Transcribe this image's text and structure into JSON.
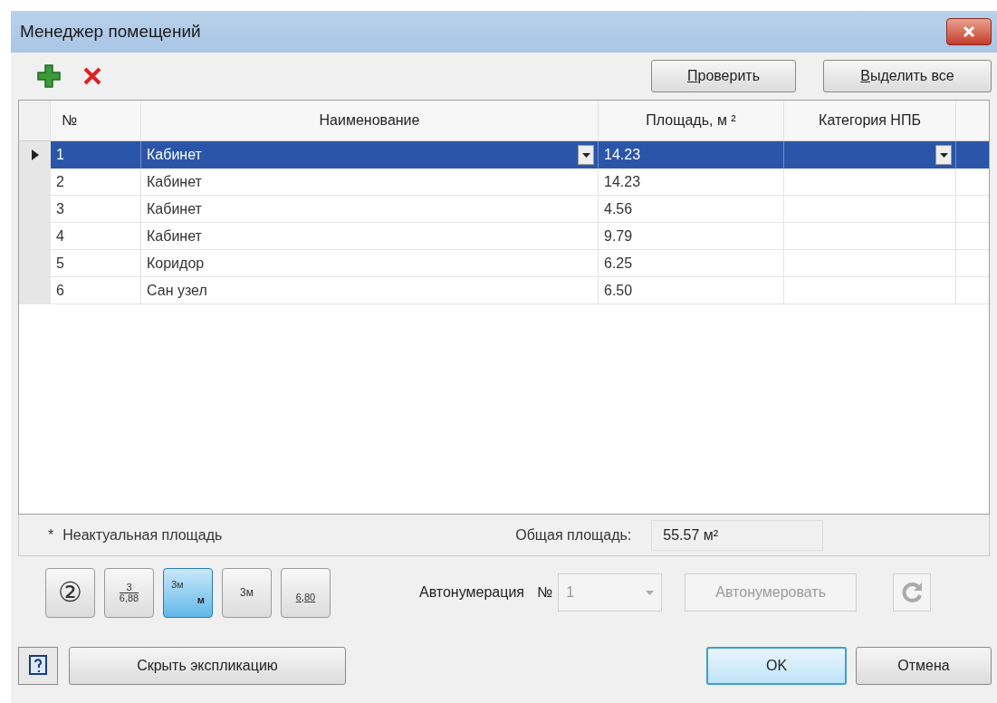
{
  "window": {
    "title": "Менеджер помещений"
  },
  "toolbar": {
    "buttons": [
      {
        "mnemonic": "П",
        "rest": "роверить"
      },
      {
        "mnemonic": "В",
        "rest": "ыделить все"
      }
    ]
  },
  "table": {
    "columns": [
      "№",
      "Наименование",
      "Площадь, м ²",
      "Категория НПБ"
    ],
    "rows": [
      {
        "number": "1",
        "name": "Кабинет",
        "area": "14.23",
        "category": "",
        "selected": true
      },
      {
        "number": "2",
        "name": "Кабинет",
        "area": "14.23",
        "category": "",
        "selected": false
      },
      {
        "number": "3",
        "name": "Кабинет",
        "area": "4.56",
        "category": "",
        "selected": false
      },
      {
        "number": "4",
        "name": "Кабинет",
        "area": "9.79",
        "category": "",
        "selected": false
      },
      {
        "number": "5",
        "name": "Коридор",
        "area": "6.25",
        "category": "",
        "selected": false
      },
      {
        "number": "6",
        "name": "Сан узел",
        "area": "6.50",
        "category": "",
        "selected": false
      }
    ]
  },
  "footer": {
    "note_mark": "*",
    "note": "Неактуальная площадь",
    "total_label": "Общая площадь:",
    "total_value": "55.57 м²"
  },
  "label_styles": [
    {
      "kind": "circle",
      "lines": [
        "②"
      ],
      "selected": false
    },
    {
      "kind": "fraction",
      "lines": [
        "3",
        "6,88"
      ],
      "selected": false
    },
    {
      "kind": "stacked",
      "lines": [
        "3м",
        "м"
      ],
      "selected": true
    },
    {
      "kind": "single",
      "lines": [
        "3м"
      ],
      "selected": false
    },
    {
      "kind": "underlined",
      "lines": [
        "6,80"
      ],
      "selected": false
    }
  ],
  "autonumber": {
    "label": "Автонумерация",
    "number_label": "№",
    "value": "1",
    "disabled": true,
    "button": "Автонумеровать",
    "button_disabled": true
  },
  "bottom": {
    "hide_button": "Скрыть экспликацию",
    "ok": "OK",
    "cancel": "Отмена"
  }
}
